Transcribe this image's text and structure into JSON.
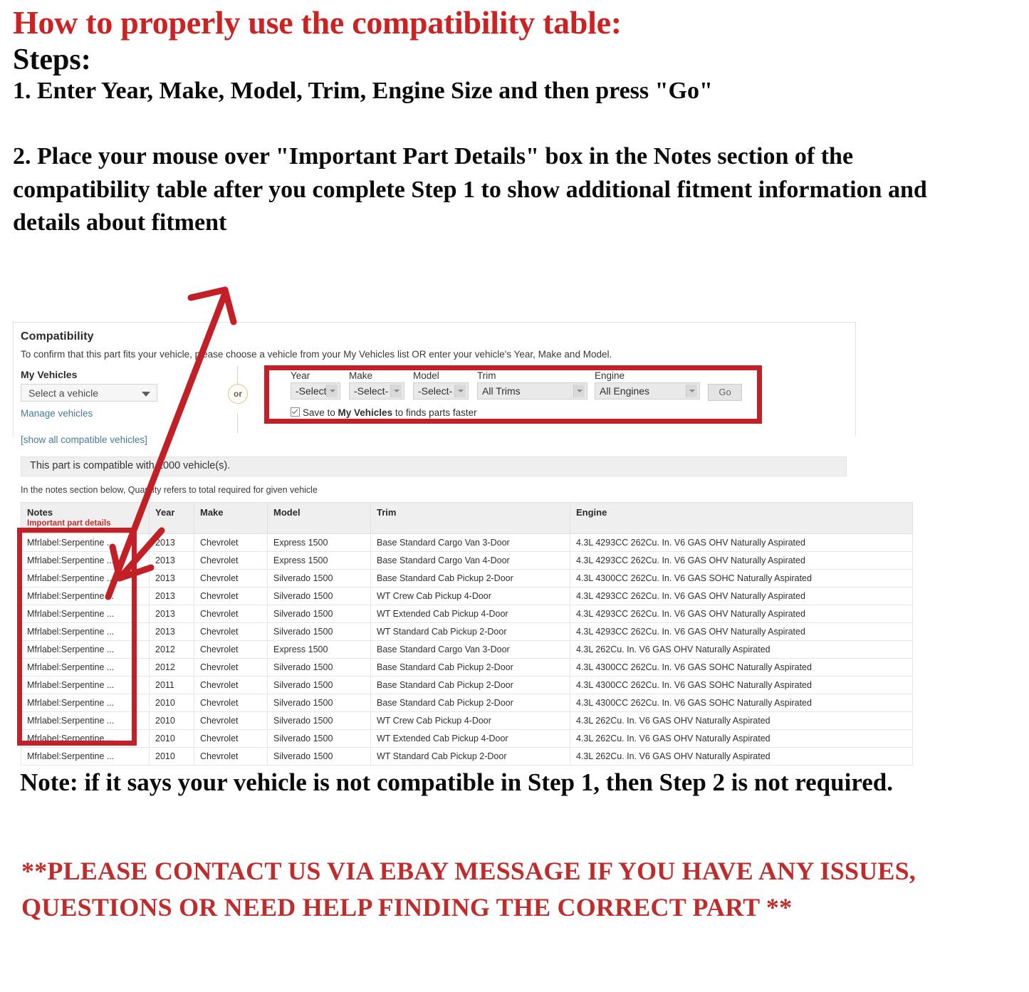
{
  "instructions": {
    "heading": "How to properly use the compatibility table:",
    "steps_label": "Steps:",
    "step1": "1. Enter Year, Make, Model, Trim, Engine Size and then press \"Go\"",
    "step2": "2. Place your mouse over \"Important Part Details\" box in the Notes section of the compatibility table after you complete Step 1 to show additional fitment information and details about fitment"
  },
  "compatibility": {
    "title": "Compatibility",
    "subtitle": "To confirm that this part fits your vehicle, please choose a vehicle from your My Vehicles list OR enter your vehicle's Year, Make and Model.",
    "my_vehicles_label": "My Vehicles",
    "my_vehicles_value": "Select a vehicle",
    "manage_vehicles_link": "Manage vehicles",
    "show_all_link": "[show all compatible vehicles]",
    "or_text": "or",
    "fields": [
      {
        "label": "Year",
        "value": "-Select-"
      },
      {
        "label": "Make",
        "value": "-Select-"
      },
      {
        "label": "Model",
        "value": "-Select-"
      },
      {
        "label": "Trim",
        "value": "All Trims"
      },
      {
        "label": "Engine",
        "value": "All Engines"
      }
    ],
    "go_label": "Go",
    "save_prefix": "Save to ",
    "save_bold": "My Vehicles",
    "save_suffix": " to finds parts faster",
    "banner": "This part is compatible with 1000 vehicle(s).",
    "notes_hint": "In the notes section below, Quantity refers to total required for given vehicle"
  },
  "table": {
    "headers": {
      "notes": "Notes",
      "notes_sub": "Important part details",
      "year": "Year",
      "make": "Make",
      "model": "Model",
      "trim": "Trim",
      "engine": "Engine"
    },
    "rows": [
      {
        "notes": "Mfrlabel:Serpentine ...",
        "year": "2013",
        "make": "Chevrolet",
        "model": "Express 1500",
        "trim": "Base Standard Cargo Van 3-Door",
        "engine": "4.3L 4293CC 262Cu. In. V6 GAS OHV Naturally Aspirated"
      },
      {
        "notes": "Mfrlabel:Serpentine ...",
        "year": "2013",
        "make": "Chevrolet",
        "model": "Express 1500",
        "trim": "Base Standard Cargo Van 4-Door",
        "engine": "4.3L 4293CC 262Cu. In. V6 GAS OHV Naturally Aspirated"
      },
      {
        "notes": "Mfrlabel:Serpentine ...",
        "year": "2013",
        "make": "Chevrolet",
        "model": "Silverado 1500",
        "trim": "Base Standard Cab Pickup 2-Door",
        "engine": "4.3L 4300CC 262Cu. In. V6 GAS SOHC Naturally Aspirated"
      },
      {
        "notes": "Mfrlabel:Serpentine ...",
        "year": "2013",
        "make": "Chevrolet",
        "model": "Silverado 1500",
        "trim": "WT Crew Cab Pickup 4-Door",
        "engine": "4.3L 4293CC 262Cu. In. V6 GAS OHV Naturally Aspirated"
      },
      {
        "notes": "Mfrlabel:Serpentine ...",
        "year": "2013",
        "make": "Chevrolet",
        "model": "Silverado 1500",
        "trim": "WT Extended Cab Pickup 4-Door",
        "engine": "4.3L 4293CC 262Cu. In. V6 GAS OHV Naturally Aspirated"
      },
      {
        "notes": "Mfrlabel:Serpentine ...",
        "year": "2013",
        "make": "Chevrolet",
        "model": "Silverado 1500",
        "trim": "WT Standard Cab Pickup 2-Door",
        "engine": "4.3L 4293CC 262Cu. In. V6 GAS OHV Naturally Aspirated"
      },
      {
        "notes": "Mfrlabel:Serpentine ...",
        "year": "2012",
        "make": "Chevrolet",
        "model": "Express 1500",
        "trim": "Base Standard Cargo Van 3-Door",
        "engine": "4.3L 262Cu. In. V6 GAS OHV Naturally Aspirated"
      },
      {
        "notes": "Mfrlabel:Serpentine ...",
        "year": "2012",
        "make": "Chevrolet",
        "model": "Silverado 1500",
        "trim": "Base Standard Cab Pickup 2-Door",
        "engine": "4.3L 4300CC 262Cu. In. V6 GAS SOHC Naturally Aspirated"
      },
      {
        "notes": "Mfrlabel:Serpentine ...",
        "year": "2011",
        "make": "Chevrolet",
        "model": "Silverado 1500",
        "trim": "Base Standard Cab Pickup 2-Door",
        "engine": "4.3L 4300CC 262Cu. In. V6 GAS SOHC Naturally Aspirated"
      },
      {
        "notes": "Mfrlabel:Serpentine ...",
        "year": "2010",
        "make": "Chevrolet",
        "model": "Silverado 1500",
        "trim": "Base Standard Cab Pickup 2-Door",
        "engine": "4.3L 4300CC 262Cu. In. V6 GAS SOHC Naturally Aspirated"
      },
      {
        "notes": "Mfrlabel:Serpentine ...",
        "year": "2010",
        "make": "Chevrolet",
        "model": "Silverado 1500",
        "trim": "WT Crew Cab Pickup 4-Door",
        "engine": "4.3L 262Cu. In. V6 GAS OHV Naturally Aspirated"
      },
      {
        "notes": "Mfrlabel:Serpentine ...",
        "year": "2010",
        "make": "Chevrolet",
        "model": "Silverado 1500",
        "trim": "WT Extended Cab Pickup 4-Door",
        "engine": "4.3L 262Cu. In. V6 GAS OHV Naturally Aspirated"
      },
      {
        "notes": "Mfrlabel:Serpentine ...",
        "year": "2010",
        "make": "Chevrolet",
        "model": "Silverado 1500",
        "trim": "WT Standard Cab Pickup 2-Door",
        "engine": "4.3L 262Cu. In. V6 GAS OHV Naturally Aspirated"
      }
    ]
  },
  "footer": {
    "note": "Note: if it says your vehicle is not compatible in Step 1, then Step 2 is not required.",
    "contact": "**PLEASE CONTACT US VIA EBAY MESSAGE IF YOU HAVE ANY ISSUES, QUESTIONS OR NEED HELP FINDING THE CORRECT PART **"
  },
  "colors": {
    "annotation_red": "#c22026",
    "heading_red": "#cc2222",
    "link_blue": "#4a7a93"
  }
}
